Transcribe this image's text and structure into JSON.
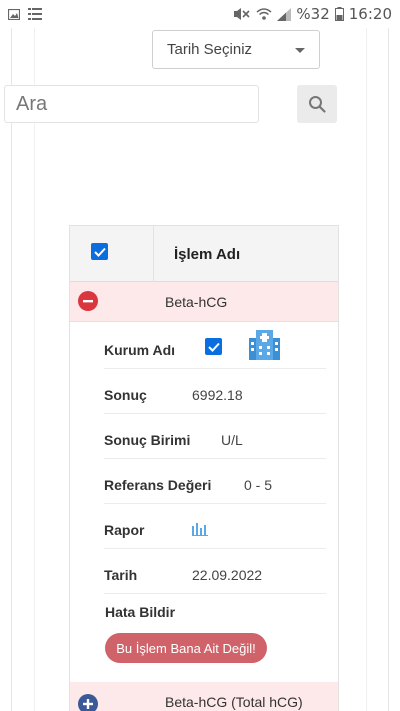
{
  "statusbar": {
    "battery_pct": "%32",
    "time": "16:20"
  },
  "filters": {
    "date_select_label": "Tarih Seçiniz",
    "search_placeholder": "Ara"
  },
  "table": {
    "header_label": "İşlem Adı",
    "rows": [
      {
        "name": "Beta-hCG",
        "expanded": true,
        "details": {
          "kurum_label": "Kurum Adı",
          "sonuc_label": "Sonuç",
          "sonuc_value": "6992.18",
          "birim_label": "Sonuç Birimi",
          "birim_value": "U/L",
          "referans_label": "Referans Değeri",
          "referans_value": "0 - 5",
          "rapor_label": "Rapor",
          "tarih_label": "Tarih",
          "tarih_value": "22.09.2022",
          "hata_label": "Hata Bildir",
          "hata_button": "Bu İşlem Bana Ait Değil!"
        }
      },
      {
        "name": "Beta-hCG (Total hCG)",
        "expanded": false
      }
    ]
  },
  "colors": {
    "accent_blue": "#0a6ee0",
    "row_highlight": "#fde9e9",
    "danger": "#d0636a"
  }
}
